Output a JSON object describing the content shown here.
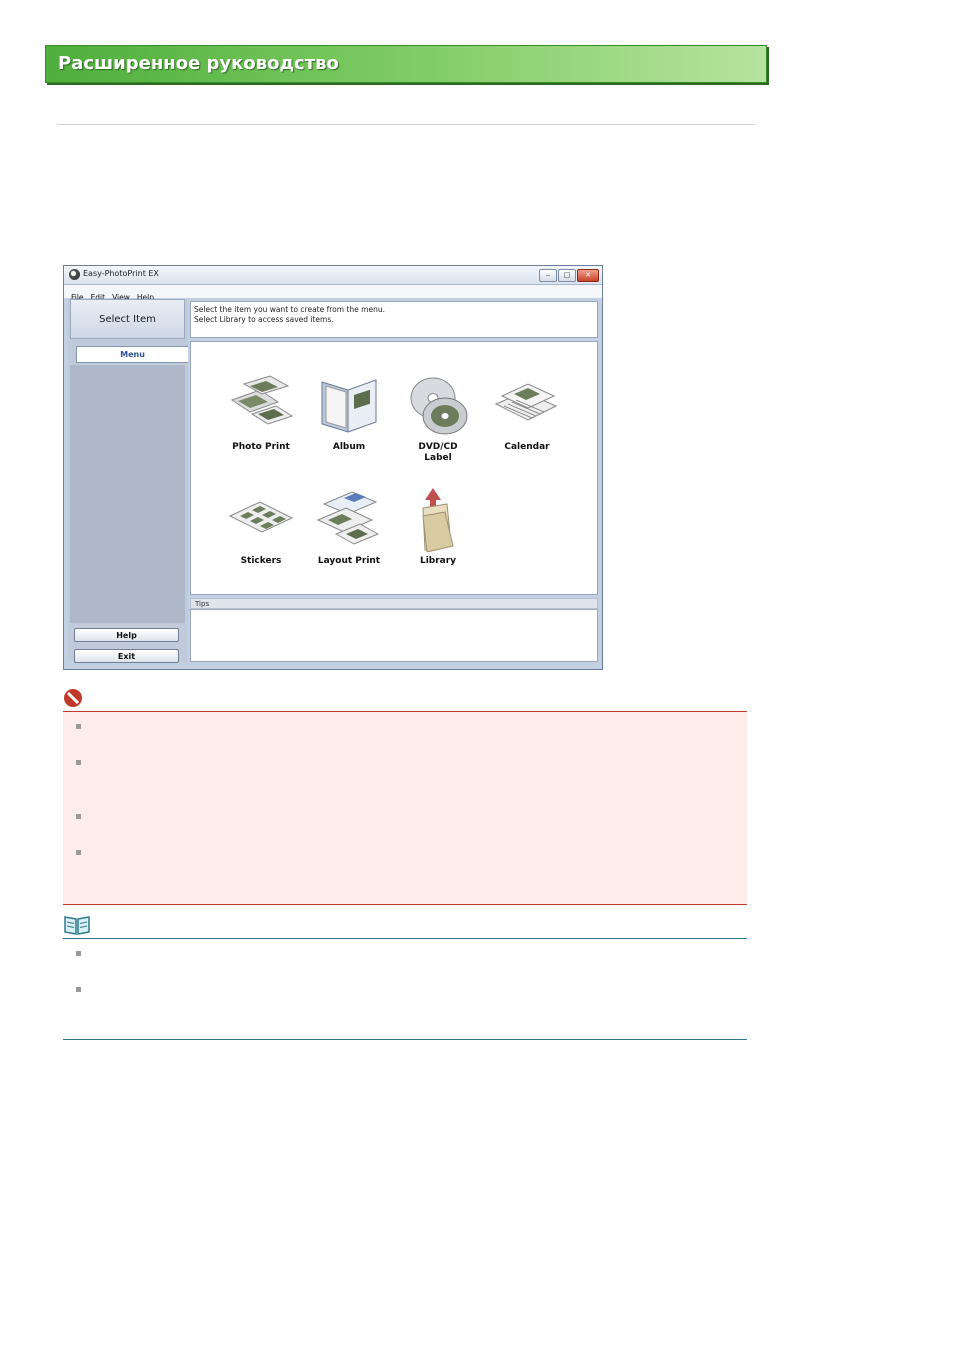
{
  "header": {
    "title": "Расширенное руководство"
  },
  "window": {
    "title": "Easy-PhotoPrint EX",
    "menu": [
      "File",
      "Edit",
      "View",
      "Help"
    ],
    "sidebar": {
      "heading": "Select Item",
      "tab": "Menu",
      "help_button": "Help",
      "exit_button": "Exit"
    },
    "instructions": [
      "Select the item you want to create from the menu.",
      "Select Library to access saved items."
    ],
    "items": [
      {
        "label": "Photo Print",
        "icon": "photo-print-icon"
      },
      {
        "label": "Album",
        "icon": "album-icon"
      },
      {
        "label": "DVD/CD Label",
        "icon": "disc-label-icon"
      },
      {
        "label": "Calendar",
        "icon": "calendar-icon"
      },
      {
        "label": "Stickers",
        "icon": "stickers-icon"
      },
      {
        "label": "Layout Print",
        "icon": "layout-print-icon"
      },
      {
        "label": "Library",
        "icon": "library-icon"
      }
    ],
    "tips_label": "Tips"
  },
  "colors": {
    "banner": "#5fb648",
    "caution": "#c0392b",
    "caution_bg": "#fcecea",
    "note": "#2e7a8a"
  }
}
